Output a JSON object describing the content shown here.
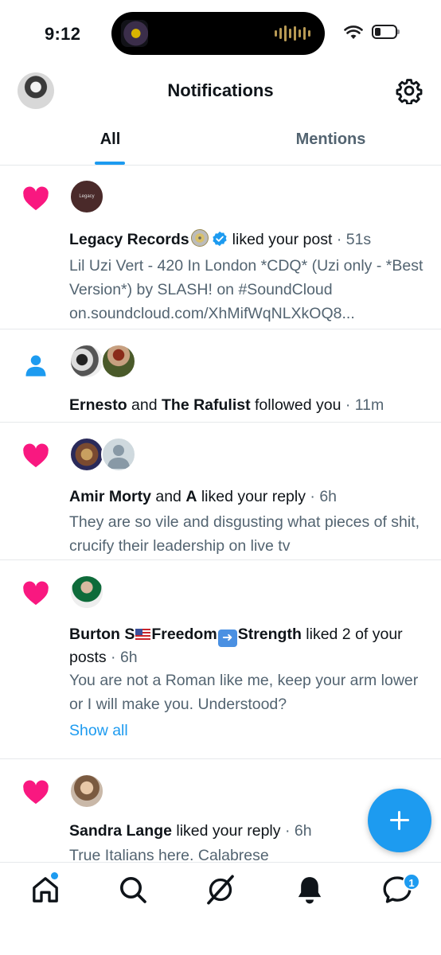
{
  "status_bar": {
    "time": "9:12"
  },
  "header": {
    "title": "Notifications"
  },
  "tabs": [
    {
      "label": "All"
    },
    {
      "label": "Mentions"
    }
  ],
  "notifications": [
    {
      "type": "like",
      "actor": "Legacy Records",
      "action": "liked your post",
      "time": "· 51s",
      "avatar_text": "Legacy",
      "body": "Lil Uzi Vert - 420 In London *CDQ* (Uzi only - *Best Version*) by SLASH! on #SoundCloud on.soundcloud.com/XhMifWqNLXkOQ8..."
    },
    {
      "type": "follow",
      "actor1": "Ernesto",
      "joiner": "and",
      "actor2": "The Rafulist",
      "action": "followed you",
      "time": "· 11m"
    },
    {
      "type": "like",
      "actor1": "Amir Morty",
      "joiner": "and",
      "actor2": "A",
      "action": "liked your reply",
      "time": "· 6h",
      "body": "They are so vile and disgusting what pieces of shit, crucify their leadership on live tv"
    },
    {
      "type": "like",
      "actor_part1": "Burton S",
      "actor_part2": "Freedom",
      "actor_part3": "Strength",
      "action": "liked 2 of your posts",
      "time": "· 6h",
      "body": "You are not a Roman like me, keep your arm lower or I will make you. Understood?",
      "show_all": "Show all"
    },
    {
      "type": "like",
      "actor": "Sandra Lange",
      "action": "liked your reply",
      "time": "· 6h",
      "body": "True Italians here. Calabrese"
    }
  ],
  "bottom_nav": {
    "items": [
      "home-icon",
      "search-icon",
      "grok-icon",
      "bell-icon",
      "messages-icon"
    ],
    "messages_badge": "1"
  },
  "colors": {
    "accent": "#1d9bf0",
    "like": "#f91880",
    "text": "#0f1419",
    "secondary": "#536471"
  }
}
